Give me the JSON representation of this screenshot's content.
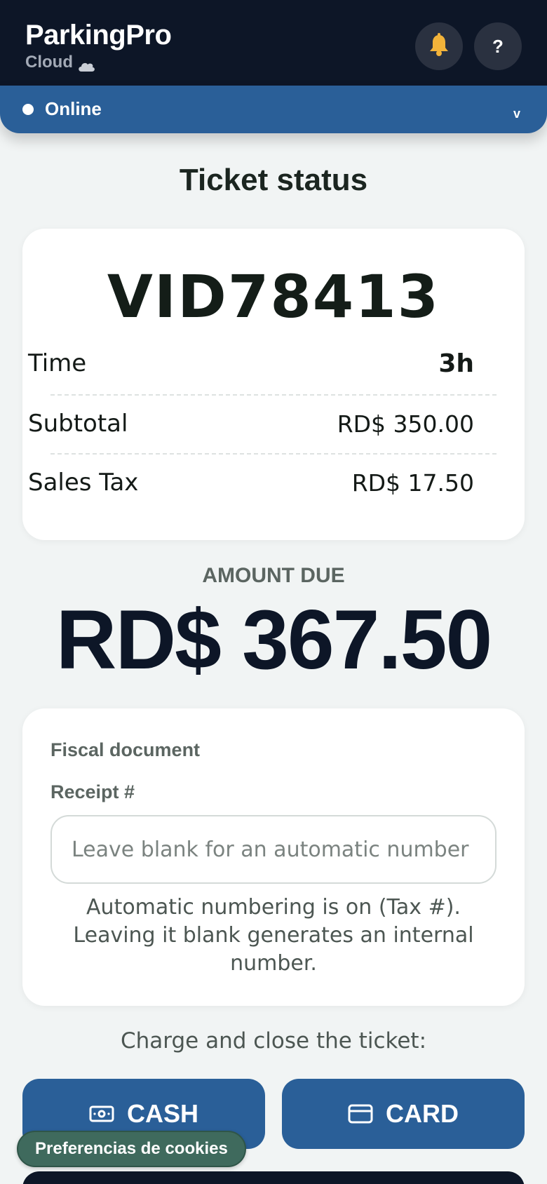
{
  "app": {
    "name": "ParkingPro",
    "subtitle": "Cloud"
  },
  "header": {
    "help_label": "?"
  },
  "status": {
    "text": "Online",
    "chevron": "v"
  },
  "page": {
    "title": "Ticket status"
  },
  "ticket": {
    "id": "VID78413",
    "rows": [
      {
        "label": "Time",
        "value": "3h"
      },
      {
        "label": "Subtotal",
        "value": "RD$ 350.00"
      },
      {
        "label": "Sales Tax",
        "value": "RD$ 17.50"
      }
    ]
  },
  "amount_due": {
    "label": "AMOUNT DUE",
    "value": "RD$ 367.50"
  },
  "fiscal": {
    "title": "Fiscal document",
    "receipt_label": "Receipt #",
    "receipt_value": "",
    "receipt_placeholder": "Leave blank for an automatic number",
    "note": "Automatic numbering is on (Tax #). Leaving it blank generates an internal number."
  },
  "charge": {
    "label": "Charge and close the ticket:",
    "cash_label": "CASH",
    "card_label": "CARD"
  },
  "cookie": {
    "label": "Preferencias de cookies"
  },
  "icons": {
    "bell": "bell-icon",
    "help": "help-icon",
    "cloud": "cloud-icon",
    "cash": "cash-icon",
    "card": "credit-card-icon"
  },
  "colors": {
    "header_bg": "#0d1627",
    "accent": "#2a5f98",
    "page_bg": "#f1f4f4",
    "cookie_bg": "#3f6a5d",
    "bell": "#f2b33a"
  }
}
